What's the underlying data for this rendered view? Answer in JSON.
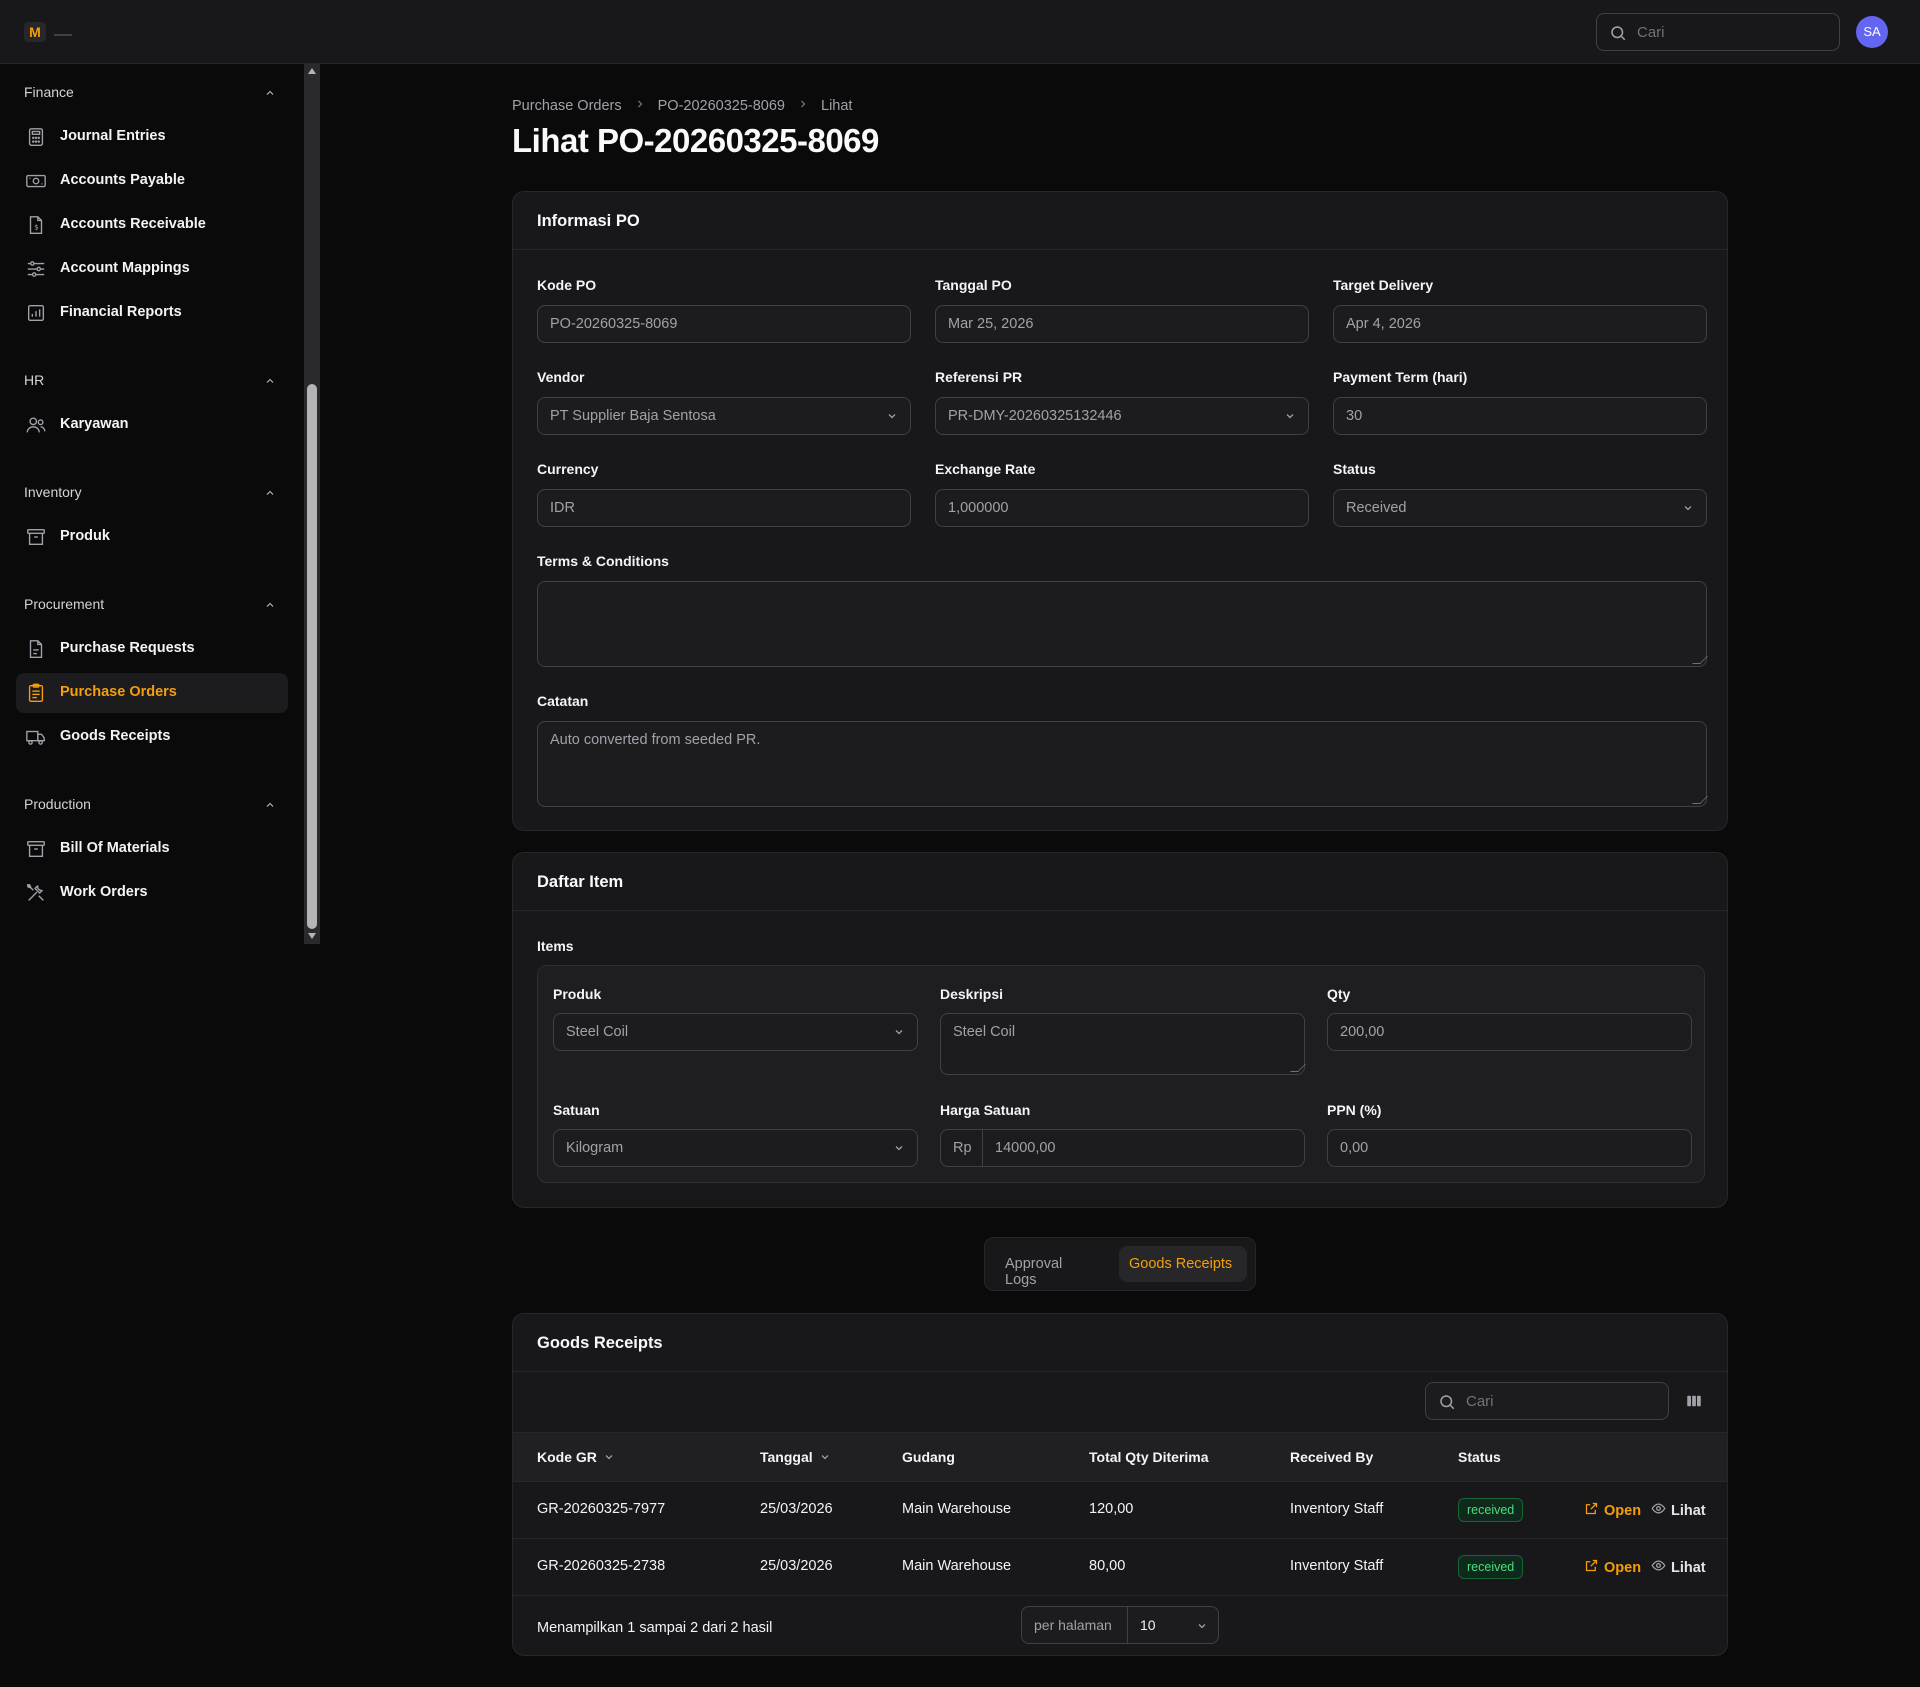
{
  "app": {
    "logo_letter": "M"
  },
  "topbar": {
    "search_placeholder": "Cari",
    "avatar_initials": "SA"
  },
  "sidebar": {
    "groups": [
      {
        "label": "Finance",
        "items": [
          {
            "label": "Journal Entries",
            "icon": "calculator-icon"
          },
          {
            "label": "Accounts Payable",
            "icon": "banknote-icon"
          },
          {
            "label": "Accounts Receivable",
            "icon": "document-dollar-icon"
          },
          {
            "label": "Account Mappings",
            "icon": "sliders-icon"
          },
          {
            "label": "Financial Reports",
            "icon": "bar-chart-icon"
          }
        ]
      },
      {
        "label": "HR",
        "items": [
          {
            "label": "Karyawan",
            "icon": "users-icon"
          }
        ]
      },
      {
        "label": "Inventory",
        "items": [
          {
            "label": "Produk",
            "icon": "archive-box-icon"
          }
        ]
      },
      {
        "label": "Procurement",
        "items": [
          {
            "label": "Purchase Requests",
            "icon": "document-icon"
          },
          {
            "label": "Purchase Orders",
            "icon": "clipboard-list-icon",
            "active": true
          },
          {
            "label": "Goods Receipts",
            "icon": "truck-icon"
          }
        ]
      },
      {
        "label": "Production",
        "items": [
          {
            "label": "Bill Of Materials",
            "icon": "archive-box-icon"
          },
          {
            "label": "Work Orders",
            "icon": "wrench-screwdriver-icon"
          }
        ]
      }
    ]
  },
  "breadcrumb": [
    "Purchase Orders",
    "PO-20260325-8069",
    "Lihat"
  ],
  "page_title": "Lihat PO-20260325-8069",
  "info_card": {
    "title": "Informasi PO",
    "kode_po": {
      "label": "Kode PO",
      "value": "PO-20260325-8069"
    },
    "tanggal_po": {
      "label": "Tanggal PO",
      "value": "Mar 25, 2026"
    },
    "target_delivery": {
      "label": "Target Delivery",
      "value": "Apr 4, 2026"
    },
    "vendor": {
      "label": "Vendor",
      "value": "PT Supplier Baja Sentosa"
    },
    "referensi_pr": {
      "label": "Referensi PR",
      "value": "PR-DMY-20260325132446"
    },
    "payment_term": {
      "label": "Payment Term (hari)",
      "value": "30"
    },
    "currency": {
      "label": "Currency",
      "value": "IDR"
    },
    "exchange_rate": {
      "label": "Exchange Rate",
      "value": "1,000000"
    },
    "status": {
      "label": "Status",
      "value": "Received"
    },
    "terms": {
      "label": "Terms & Conditions",
      "value": ""
    },
    "catatan": {
      "label": "Catatan",
      "value": "Auto converted from seeded PR."
    }
  },
  "items_card": {
    "title": "Daftar Item",
    "items_label": "Items",
    "produk": {
      "label": "Produk",
      "value": "Steel Coil"
    },
    "deskripsi": {
      "label": "Deskripsi",
      "value": "Steel Coil"
    },
    "qty": {
      "label": "Qty",
      "value": "200,00"
    },
    "satuan": {
      "label": "Satuan",
      "value": "Kilogram"
    },
    "harga": {
      "label": "Harga Satuan",
      "prefix": "Rp",
      "value": "14000,00"
    },
    "ppn": {
      "label": "PPN (%)",
      "value": "0,00"
    }
  },
  "tabs": [
    {
      "label": "Approval Logs"
    },
    {
      "label": "Goods Receipts",
      "active": true
    }
  ],
  "gr_card": {
    "title": "Goods Receipts",
    "search_placeholder": "Cari",
    "columns": [
      "Kode GR",
      "Tanggal",
      "Gudang",
      "Total Qty Diterima",
      "Received By",
      "Status"
    ],
    "rows": [
      {
        "kode": "GR-20260325-7977",
        "tanggal": "25/03/2026",
        "gudang": "Main Warehouse",
        "qty": "120,00",
        "by": "Inventory Staff",
        "status": "received"
      },
      {
        "kode": "GR-20260325-2738",
        "tanggal": "25/03/2026",
        "gudang": "Main Warehouse",
        "qty": "80,00",
        "by": "Inventory Staff",
        "status": "received"
      }
    ],
    "action_open": "Open",
    "action_view": "Lihat",
    "footer": "Menampilkan 1 sampai 2 dari 2 hasil",
    "per_page_label": "per halaman",
    "per_page_value": "10"
  },
  "colors": {
    "accent": "#f59e0b",
    "background": "#0a0a0b",
    "card": "#18181b",
    "success": "#4ade80"
  }
}
